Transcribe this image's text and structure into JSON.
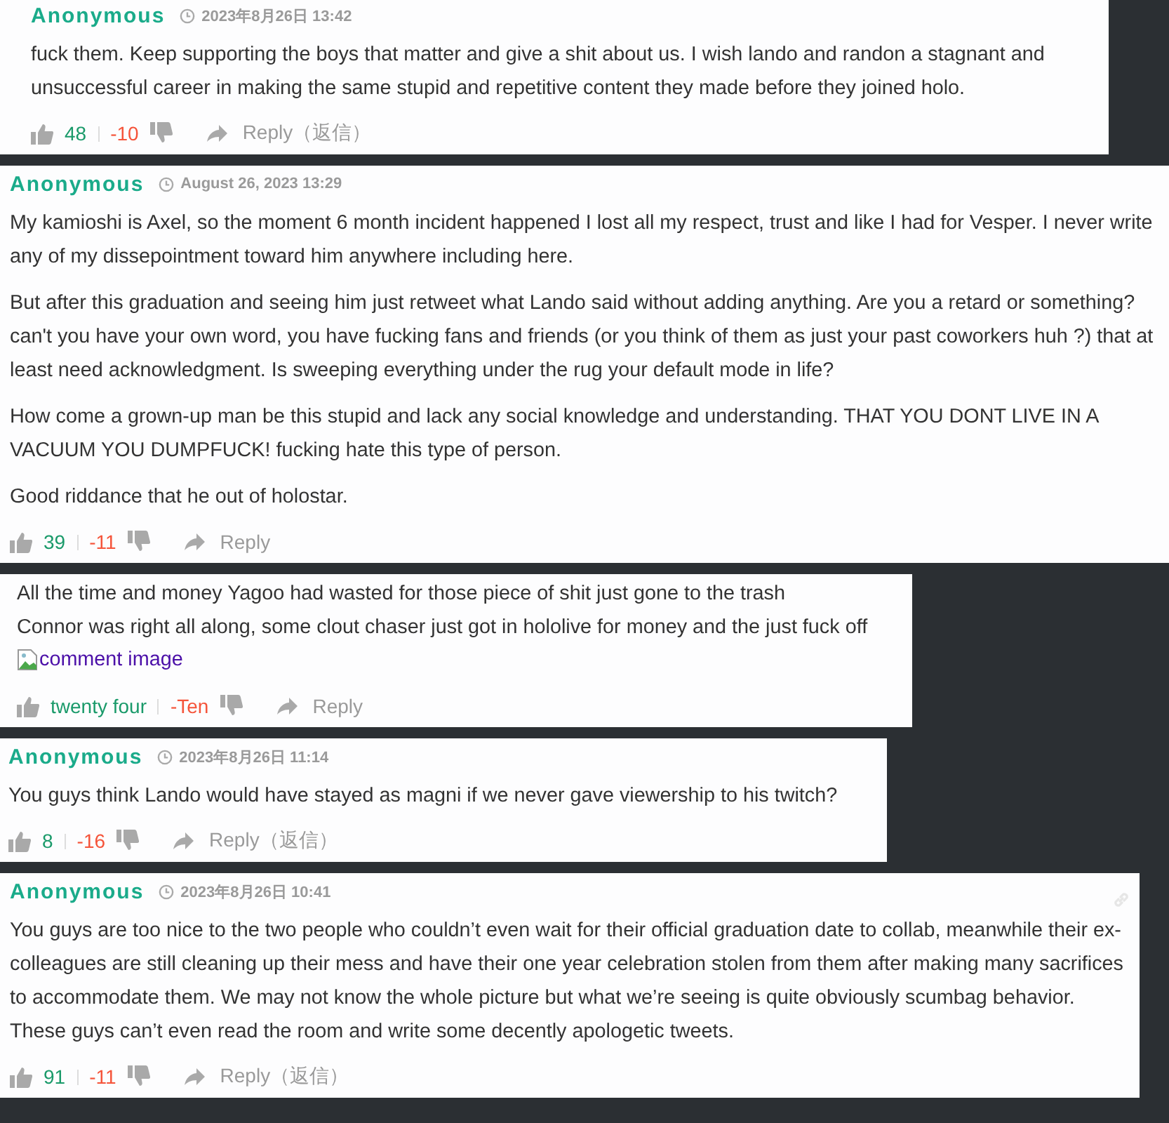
{
  "comments": [
    {
      "author": "Anonymous",
      "date": "2023年8月26日 13:42",
      "hovered": false,
      "paragraphs": [
        "fuck them. Keep supporting the boys that matter and give a shit about us. I wish lando and randon a stagnant and unsuccessful career in making the same stupid and repetitive content they made before they joined holo."
      ],
      "likes": "48",
      "dislikes": "-10",
      "reply": "Reply（返信）"
    },
    {
      "author": "Anonymous",
      "date": "August 26, 2023 13:29",
      "hovered": false,
      "paragraphs": [
        "My kamioshi is Axel, so the moment 6 month incident happened I lost all my respect, trust and like I had for Vesper. I never write any of my dissepointment toward him anywhere including here.",
        "But after this graduation and seeing him just retweet what Lando said without adding anything. Are you a retard or something? can't you have your own word, you have fucking fans and friends (or you think of them as just your past coworkers huh ?) that at least need acknowledgment. Is sweeping everything under the rug your default mode in life?",
        "How come a grown-up man be this stupid and lack any social knowledge and understanding. THAT YOU DONT LIVE IN A VACUUM YOU DUMPFUCK! fucking hate this type of person.",
        "Good riddance that he out of holostar."
      ],
      "likes": "39",
      "dislikes": "-11",
      "reply": "Reply"
    },
    {
      "hovered": false,
      "paragraphs": [
        "All the time and money Yagoo had wasted for those piece of shit just gone to the trash\nConnor was right all along, some clout chaser just got in hololive for money and the just fuck off"
      ],
      "image_alt": "comment image",
      "likes": "twenty four",
      "dislikes": "-Ten",
      "reply": "Reply"
    },
    {
      "author": "Anonymous",
      "date": "2023年8月26日 11:14",
      "hovered": false,
      "paragraphs": [
        "You guys think Lando would have stayed as magni if we never gave viewership to his twitch?"
      ],
      "likes": "8",
      "dislikes": "-16",
      "reply": "Reply（返信）"
    },
    {
      "author": "Anonymous",
      "date": "2023年8月26日 10:41",
      "hovered": true,
      "paragraphs": [
        "You guys are too nice to the two people who couldn’t even wait for their official graduation date to collab, meanwhile their ex-colleagues are still cleaning up their mess and have their one year celebration stolen from them after making many sacrifices to accommodate them. We may not know the whole picture but what we’re seeing is quite obviously scumbag behavior. These guys can’t even read the room and write some decently apologetic tweets."
      ],
      "likes": "91",
      "dislikes": "-11",
      "reply": "Reply（返信）"
    }
  ]
}
